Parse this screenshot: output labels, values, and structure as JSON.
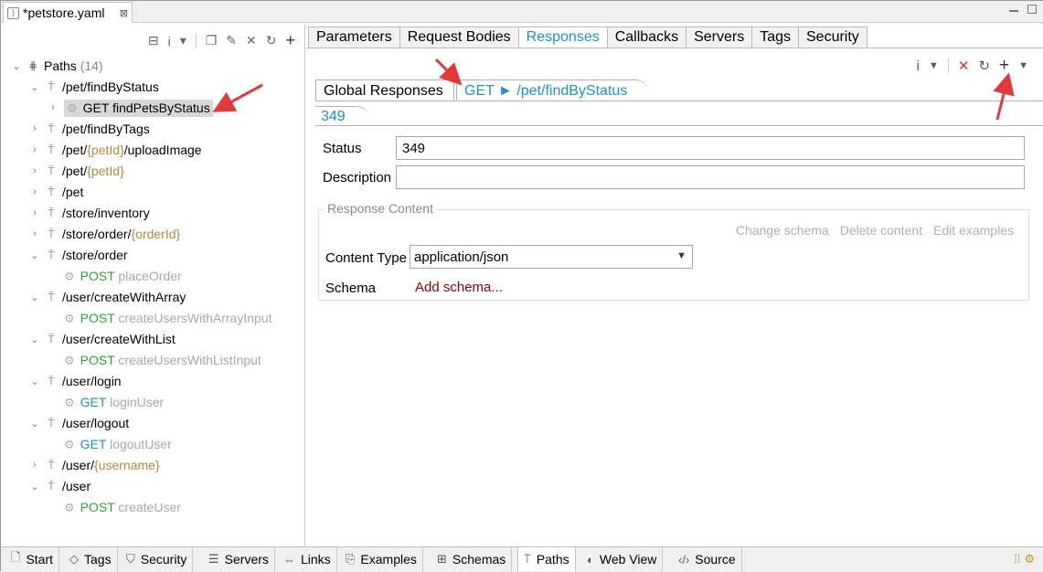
{
  "editor": {
    "tab_title": "*petstore.yaml",
    "close_glyph": "⊠"
  },
  "tree": {
    "root_label": "Paths",
    "root_count": "(14)",
    "rows": [
      {
        "path_prefix": "/pet/findByStatus",
        "param": "",
        "path_suffix": ""
      },
      {
        "method": "GET",
        "op": "findPetsByStatus"
      },
      {
        "path_prefix": "/pet/findByTags",
        "param": "",
        "path_suffix": ""
      },
      {
        "path_prefix": "/pet/",
        "param": "{petId}",
        "path_suffix": "/uploadImage"
      },
      {
        "path_prefix": "/pet/",
        "param": "{petId}",
        "path_suffix": ""
      },
      {
        "path_prefix": "/pet",
        "param": "",
        "path_suffix": ""
      },
      {
        "path_prefix": "/store/inventory",
        "param": "",
        "path_suffix": ""
      },
      {
        "path_prefix": "/store/order/",
        "param": "{orderId}",
        "path_suffix": ""
      },
      {
        "path_prefix": "/store/order",
        "param": "",
        "path_suffix": ""
      },
      {
        "method": "POST",
        "op": "placeOrder"
      },
      {
        "path_prefix": "/user/createWithArray",
        "param": "",
        "path_suffix": ""
      },
      {
        "method": "POST",
        "op": "createUsersWithArrayInput"
      },
      {
        "path_prefix": "/user/createWithList",
        "param": "",
        "path_suffix": ""
      },
      {
        "method": "POST",
        "op": "createUsersWithListInput"
      },
      {
        "path_prefix": "/user/login",
        "param": "",
        "path_suffix": ""
      },
      {
        "method": "GET",
        "op": "loginUser"
      },
      {
        "path_prefix": "/user/logout",
        "param": "",
        "path_suffix": ""
      },
      {
        "method": "GET",
        "op": "logoutUser"
      },
      {
        "path_prefix": "/user/",
        "param": "{username}",
        "path_suffix": ""
      },
      {
        "path_prefix": "/user",
        "param": "",
        "path_suffix": ""
      },
      {
        "method": "POST",
        "op": "createUser"
      }
    ]
  },
  "top_tabs": [
    "Parameters",
    "Request Bodies",
    "Responses",
    "Callbacks",
    "Servers",
    "Tags",
    "Security"
  ],
  "sub_tabs": {
    "global": "Global Responses",
    "op": "GET ► /pet/findByStatus",
    "code": "349"
  },
  "form": {
    "status_label": "Status",
    "status_value": "349",
    "description_label": "Description",
    "description_value": "",
    "group_title": "Response Content",
    "links": [
      "Change schema",
      "Delete content",
      "Edit examples"
    ],
    "content_type_label": "Content Type",
    "content_type_value": "application/json",
    "schema_label": "Schema",
    "add_schema": "Add schema..."
  },
  "bottom_tabs": [
    "Start",
    "Tags",
    "Security",
    "Servers",
    "Links",
    "Examples",
    "Schemas",
    "Paths",
    "Web View",
    "Source"
  ],
  "colors": {
    "accent": "#1e90d8",
    "post": "#2ea52e",
    "param": "#b08a40",
    "annotation_arrow": "#e03a3a",
    "add_schema": "#8b0000"
  }
}
